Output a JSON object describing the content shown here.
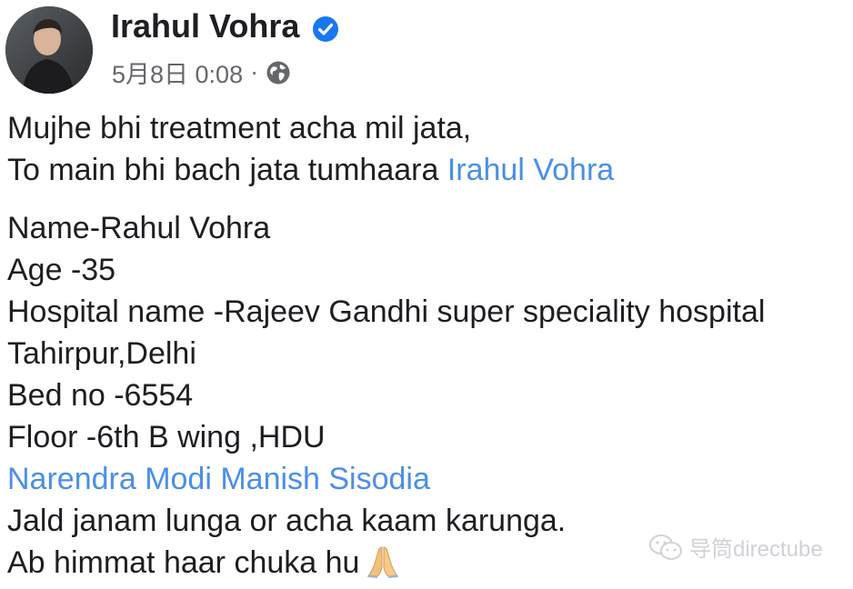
{
  "post": {
    "author_name": "Irahul Vohra",
    "timestamp": "5月8日 0:08",
    "separator": "·",
    "lines": {
      "l1": "Mujhe bhi treatment acha mil jata,",
      "l2_text": "To main bhi bach jata tumhaara ",
      "l2_link": "Irahul Vohra",
      "l3": "Name-Rahul Vohra",
      "l4": "Age -35",
      "l5": "Hospital name -Rajeev Gandhi super speciality hospital",
      "l6": "Tahirpur,Delhi",
      "l7": "Bed no -6554",
      "l8": "Floor -6th B wing ,HDU",
      "l9_link": "Narendra Modi Manish Sisodia",
      "l10": "Jald janam lunga or acha kaam karunga.",
      "l11": "Ab himmat haar chuka hu"
    }
  },
  "icons": {
    "verified": "verified-badge-icon",
    "audience": "globe-icon",
    "emoji": "folded-hands-emoji"
  },
  "watermark": {
    "text": "导筒directube"
  },
  "colors": {
    "link": "#4a8fe8",
    "verified": "#1877f2",
    "meta": "#65676b"
  }
}
